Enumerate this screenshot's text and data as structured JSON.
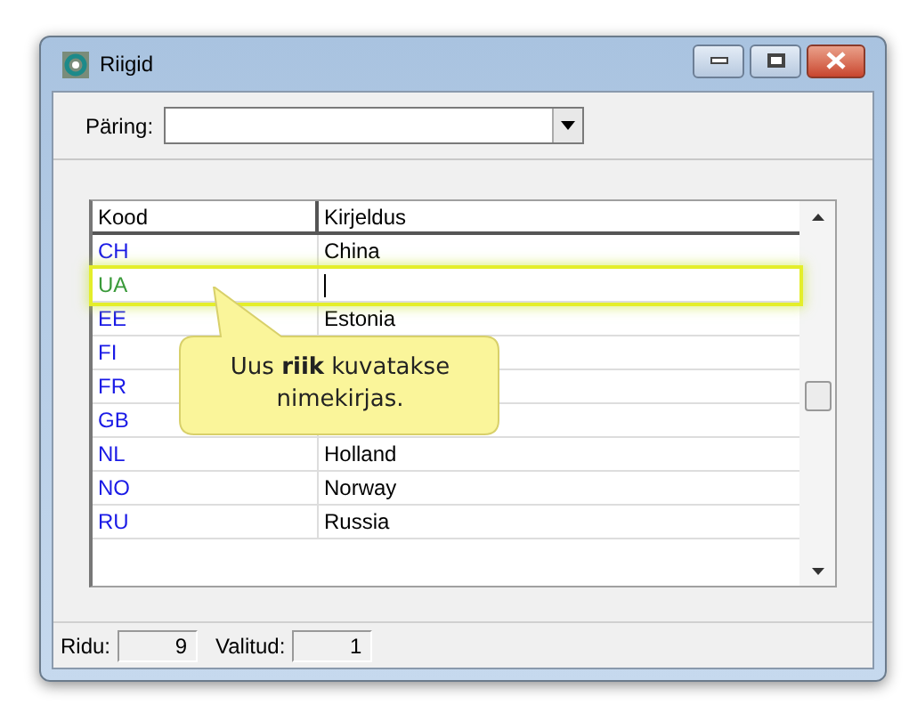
{
  "window": {
    "title": "Riigid"
  },
  "query": {
    "label": "Päring:"
  },
  "table": {
    "columns": [
      "Kood",
      "Kirjeldus"
    ],
    "rows": [
      {
        "code": "CH",
        "description": "China",
        "new": false,
        "editing": false
      },
      {
        "code": "UA",
        "new": true,
        "editing": true
      },
      {
        "code": "EE",
        "description": "Estonia",
        "new": false,
        "editing": false
      },
      {
        "code": "FI",
        "new": false,
        "editing": false
      },
      {
        "code": "FR",
        "new": false,
        "editing": false
      },
      {
        "code": "GB",
        "new": false,
        "editing": false
      },
      {
        "code": "NL",
        "description": "Holland",
        "new": false,
        "editing": false
      },
      {
        "code": "NO",
        "description": "Norway",
        "new": false,
        "editing": false
      },
      {
        "code": "RU",
        "description": "Russia",
        "new": false,
        "editing": false
      }
    ]
  },
  "callout": {
    "text": "Uus **riik** kuvatakse nimekirjas."
  },
  "status_bar": [
    {
      "label": "Ridu:",
      "value": "9"
    },
    {
      "label": "Valitud:",
      "value": "1"
    }
  ]
}
